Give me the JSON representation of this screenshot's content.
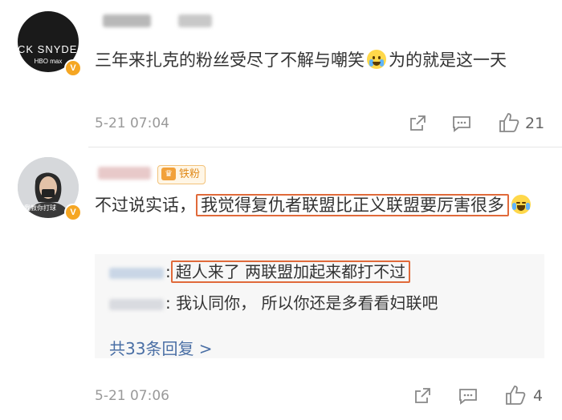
{
  "comments": [
    {
      "avatar": {
        "text": "CK SNYDER",
        "sub": "HBO max",
        "badge": "V"
      },
      "text_before": "三年来扎克的粉丝受尽了不解与嘲笑",
      "text_after": "为的就是这一天",
      "emoji": "crying-face",
      "timestamp": "5-21 07:04",
      "likes": "21"
    },
    {
      "avatar": {
        "caption": "我教你打球",
        "badge": "V"
      },
      "fan_badge": "铁粉",
      "text_before": "不过说实话，",
      "highlight": "我觉得复仇者联盟比正义联盟要厉害很多",
      "emoji": "laughing-face",
      "replies": [
        {
          "separator": ":",
          "text": "超人来了 两联盟加起来都打不过",
          "highlighted": true
        },
        {
          "separator": ":",
          "text": "我认同你， 所以你还是多看看妇联吧",
          "highlighted": false
        }
      ],
      "more_replies": "共33条回复 >",
      "timestamp": "5-21 07:06",
      "likes": "4"
    }
  ],
  "colors": {
    "highlight_border": "#e06a3a",
    "link": "#4a6fa5",
    "vip_badge": "#f5a623"
  }
}
